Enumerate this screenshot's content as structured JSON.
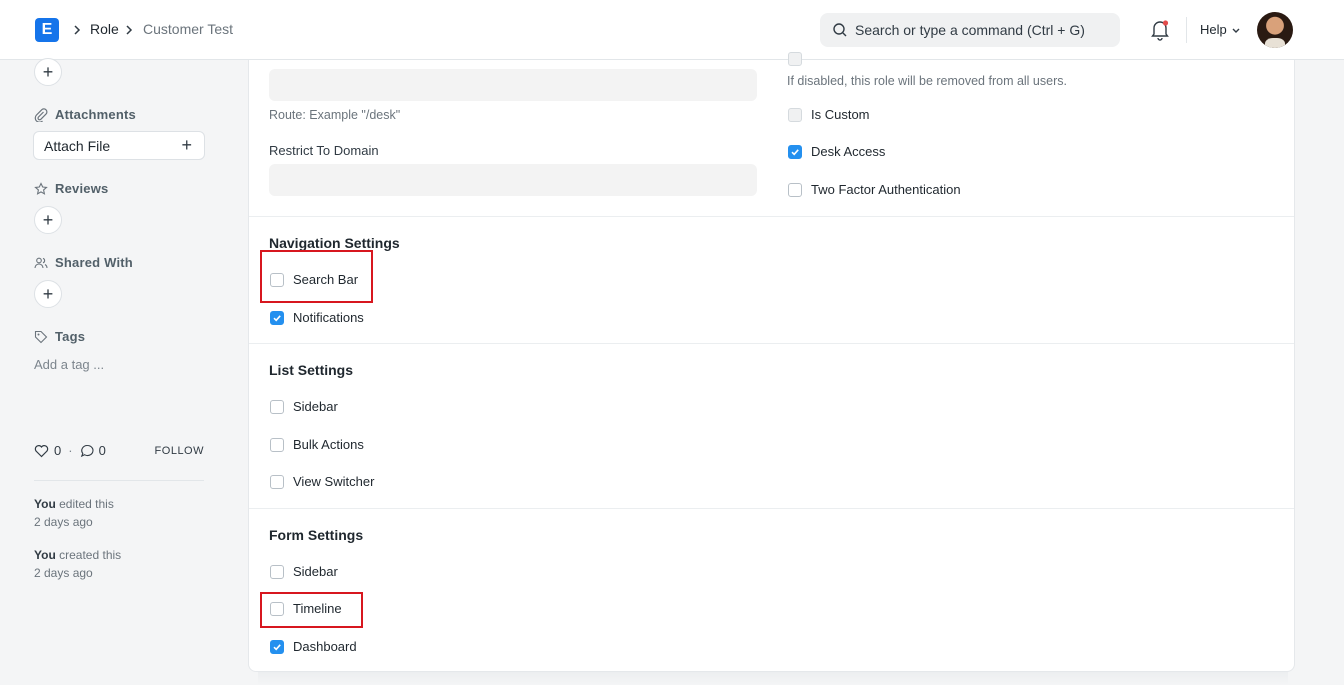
{
  "navbar": {
    "logo_letter": "E",
    "breadcrumbs": [
      "Role",
      "Customer Test"
    ],
    "search_placeholder": "Search or type a command (Ctrl + G)",
    "help_label": "Help"
  },
  "sidebar": {
    "attachments_label": "Attachments",
    "attach_file_label": "Attach File",
    "reviews_label": "Reviews",
    "shared_with_label": "Shared With",
    "tags_label": "Tags",
    "add_tag_placeholder": "Add a tag ...",
    "likes_count": "0",
    "comments_count": "0",
    "follow_label": "FOLLOW",
    "activity": [
      {
        "actor": "You",
        "action": "edited this",
        "time": "2 days ago"
      },
      {
        "actor": "You",
        "action": "created this",
        "time": "2 days ago"
      }
    ]
  },
  "form": {
    "route_hint": "Route: Example \"/desk\"",
    "restrict_domain_label": "Restrict To Domain",
    "disabled_hint": "If disabled, this role will be removed from all users.",
    "right_checkboxes": [
      {
        "label": "Is Custom",
        "checked": false
      },
      {
        "label": "Desk Access",
        "checked": true
      },
      {
        "label": "Two Factor Authentication",
        "checked": false
      }
    ],
    "sections": [
      {
        "title": "Navigation Settings",
        "items": [
          {
            "label": "Search Bar",
            "checked": false
          },
          {
            "label": "Notifications",
            "checked": true
          }
        ]
      },
      {
        "title": "List Settings",
        "items": [
          {
            "label": "Sidebar",
            "checked": false
          },
          {
            "label": "Bulk Actions",
            "checked": false
          },
          {
            "label": "View Switcher",
            "checked": false
          }
        ]
      },
      {
        "title": "Form Settings",
        "items": [
          {
            "label": "Sidebar",
            "checked": false
          },
          {
            "label": "Timeline",
            "checked": false
          },
          {
            "label": "Dashboard",
            "checked": true
          }
        ]
      }
    ]
  },
  "colors": {
    "accent": "#2490ef",
    "highlight": "#d7171f",
    "logo": "#1574ea"
  }
}
